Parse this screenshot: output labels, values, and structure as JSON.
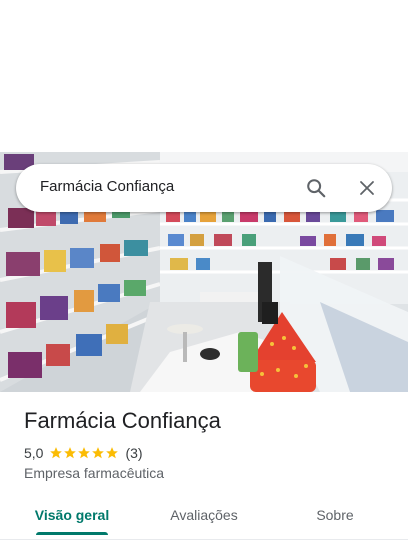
{
  "search": {
    "query": "Farmácia Confiança",
    "search_icon": "search-icon",
    "close_icon": "close-icon"
  },
  "place": {
    "name": "Farmácia Confiança",
    "rating": "5,0",
    "stars": 5,
    "review_count": "(3)",
    "category": "Empresa farmacêutica"
  },
  "tabs": [
    {
      "label": "Visão geral",
      "active": true
    },
    {
      "label": "Avaliações",
      "active": false
    },
    {
      "label": "Sobre",
      "active": false
    }
  ],
  "colors": {
    "accent": "#00796b",
    "star": "#fbbc04",
    "text_primary": "#202124",
    "text_secondary": "#5f6368"
  }
}
